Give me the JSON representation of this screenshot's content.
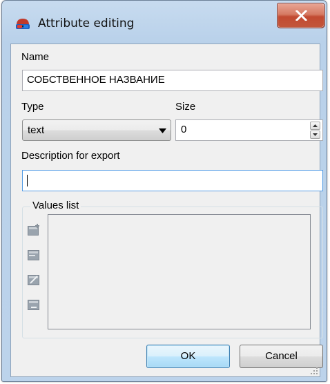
{
  "window": {
    "title": "Attribute editing",
    "app_icon": "stereo-glasses-icon",
    "close_icon": "close-x-icon"
  },
  "form": {
    "name_label": "Name",
    "name_value": "СОБСТВЕННОЕ НАЗВАНИЕ",
    "type_label": "Type",
    "type_value": "text",
    "size_label": "Size",
    "size_value": "0",
    "description_label": "Description for export",
    "description_value": ""
  },
  "values_list": {
    "title": "Values list",
    "tools": [
      "add-value-icon",
      "insert-value-icon",
      "edit-value-icon",
      "delete-value-icon"
    ]
  },
  "buttons": {
    "ok": "OK",
    "cancel": "Cancel"
  },
  "colors": {
    "accent_focus": "#569de5",
    "close_red": "#c24a31",
    "frame": "#b9d1ea"
  }
}
